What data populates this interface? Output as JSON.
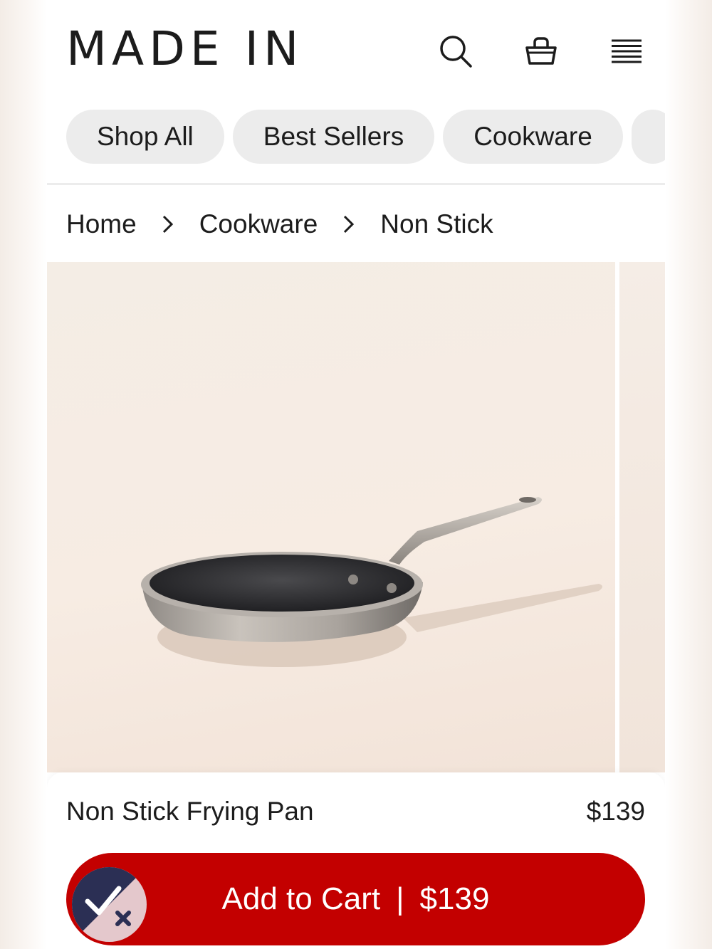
{
  "header": {
    "logo": "MADE IN",
    "icons": [
      "search-icon",
      "shopping-bag-icon",
      "menu-icon"
    ]
  },
  "categories": [
    {
      "label": "Shop All"
    },
    {
      "label": "Best Sellers"
    },
    {
      "label": "Cookware"
    }
  ],
  "breadcrumb": {
    "items": [
      {
        "label": "Home"
      },
      {
        "label": "Cookware"
      },
      {
        "label": "Non Stick"
      }
    ],
    "separator_icon": "chevron-right-icon"
  },
  "product": {
    "image": "non-stick-frying-pan-photo",
    "name": "Non Stick Frying Pan",
    "price": "$139"
  },
  "cart_button": {
    "label": "Add to Cart",
    "separator": "|",
    "price": "$139"
  },
  "badge": {
    "icon": "check-x-icon"
  },
  "colors": {
    "accent": "#c30000",
    "chip_background": "#ececec",
    "text": "#1c1c1c",
    "badge_navy": "#2b2f54"
  }
}
